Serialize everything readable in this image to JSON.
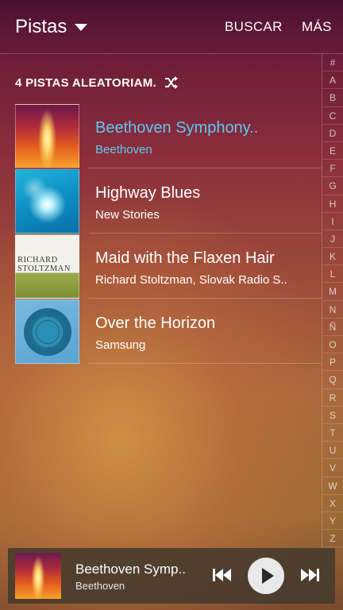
{
  "header": {
    "view_label": "Pistas",
    "search_label": "BUSCAR",
    "more_label": "MÁS"
  },
  "shuffle": {
    "label": "4 PISTAS ALEATORIAM."
  },
  "tracks": [
    {
      "title": "Beethoven Symphony..",
      "artist": "Beethoven",
      "active": true
    },
    {
      "title": "Highway Blues",
      "artist": "New Stories",
      "active": false
    },
    {
      "title": "Maid with the Flaxen Hair",
      "artist": "Richard Stoltzman, Slovak Radio S..",
      "active": false
    },
    {
      "title": "Over the Horizon",
      "artist": "Samsung",
      "active": false
    }
  ],
  "album_art_3": {
    "name_line1": "RICHARD",
    "name_line2": "STOLTZMAN"
  },
  "alphabet": [
    "#",
    "A",
    "B",
    "C",
    "D",
    "E",
    "F",
    "G",
    "H",
    "I",
    "J",
    "K",
    "L",
    "M",
    "N",
    "Ñ",
    "O",
    "P",
    "Q",
    "R",
    "S",
    "T",
    "U",
    "V",
    "W",
    "X",
    "Y",
    "Z"
  ],
  "player": {
    "title": "Beethoven Symp..",
    "artist": "Beethoven"
  },
  "colors": {
    "accent": "#5fc8f2",
    "text": "#ffffff"
  }
}
